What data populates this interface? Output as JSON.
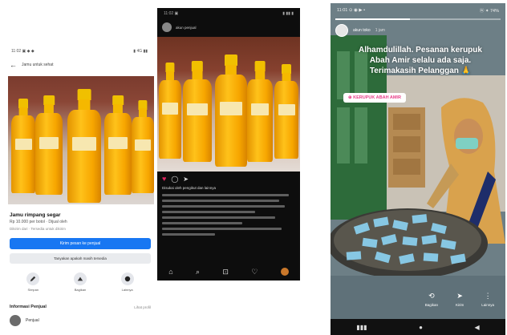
{
  "facebook_post": {
    "status_time": "11:02 ▣ ◆ ◆",
    "status_icons": "▮ 4G ▮▮",
    "appbar_title": "Jamu untuk sehat",
    "title": "Jamu rimpang segar",
    "subtitle": "Rp 10.000 per botol · Dijual oleh",
    "meta": "Dikirim dari · Tersedia untuk dikirim",
    "primary_button": "Kirim pesan ke penjual",
    "secondary_button": "Tanyakan apakah masih tersedia",
    "actions": [
      {
        "label": "Simpan"
      },
      {
        "label": "Bagikan"
      },
      {
        "label": "Lainnya"
      }
    ],
    "seller_heading": "Informasi Penjual",
    "seller_more": "Lihat profil",
    "seller_name": "Penjual"
  },
  "instagram_post": {
    "status_time": "11:02 ▣",
    "status_icons": "▮ ▮▮ ▮",
    "username": "akun penjual",
    "likes": "Disukai oleh pengikut dan lainnya"
  },
  "story": {
    "status_time": "11:01 ⊙ ◉ ▶ •",
    "status_icons": "ⓦ ✦ 74%",
    "username": "akun toko",
    "time": "1 jam",
    "caption_line1": "Alhamdulillah. Pesanan kerupuk",
    "caption_line2": "Abah Amir selalu ada saja.",
    "caption_line3": "Terimakasih Pelanggan 🙏",
    "tag": "⊕ KERUPUK ABAH AMIR",
    "actions": [
      {
        "label": "Bagikan"
      },
      {
        "label": "Kirim"
      },
      {
        "label": "Lainnya"
      }
    ],
    "progress": 0.45
  },
  "colors": {
    "facebook_blue": "#1877f2",
    "instagram_heart": "#e0245e",
    "story_tag": "#e8408a"
  }
}
